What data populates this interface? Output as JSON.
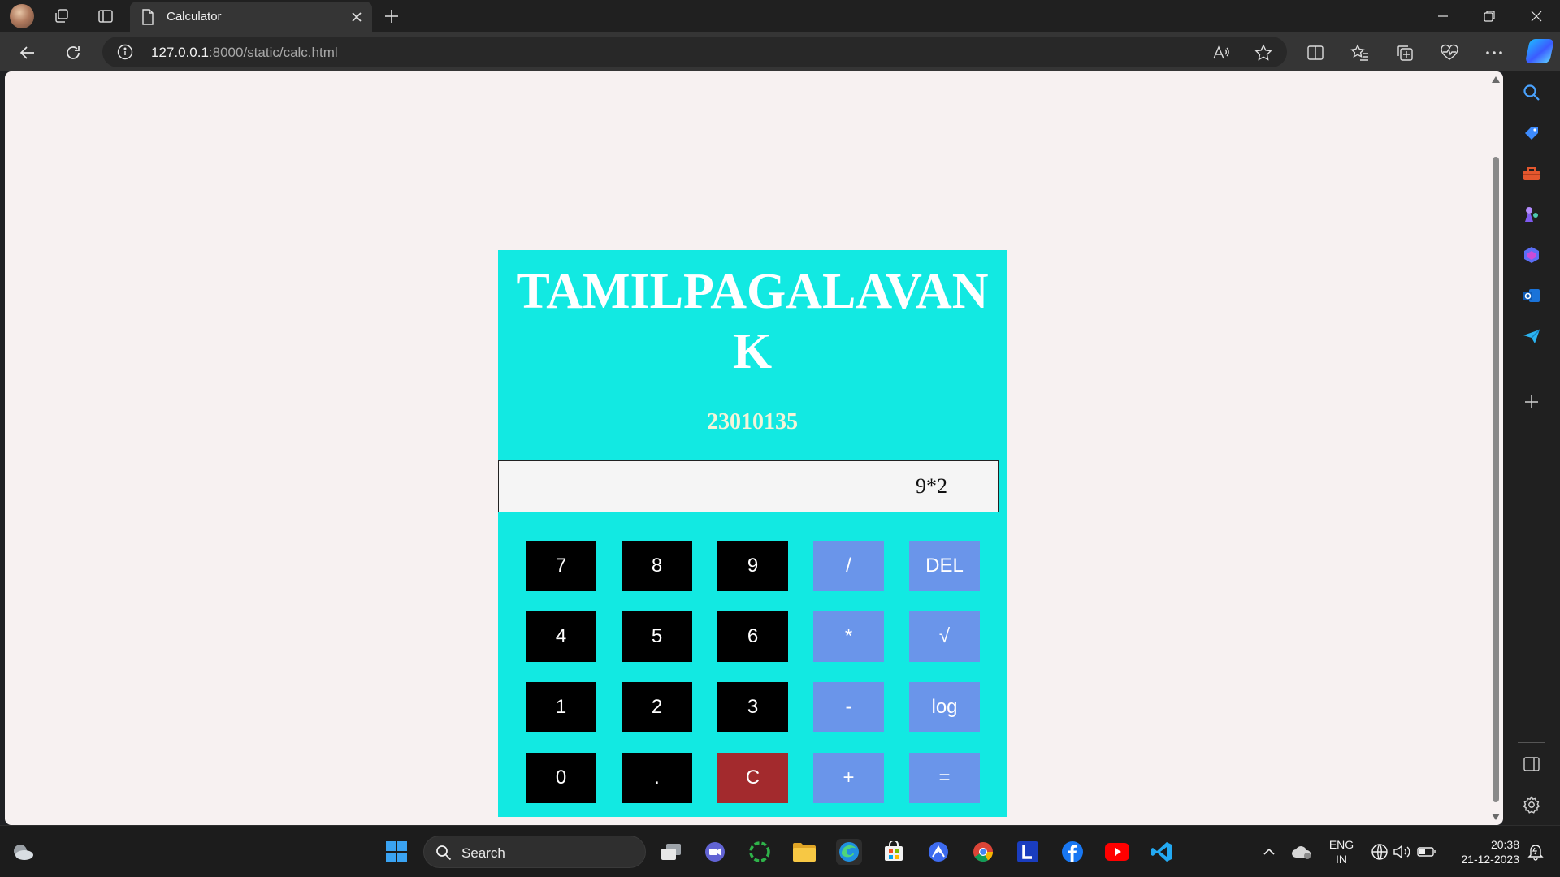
{
  "browser": {
    "tab_title": "Calculator",
    "url_host": "127.0.0.1",
    "url_rest": ":8000/static/calc.html"
  },
  "calculator": {
    "title": "TAMILPAGALAVAN K",
    "student_id": "23010135",
    "display_value": "9*2",
    "colors": {
      "panel": "#12e9e2",
      "number_key": "#000000",
      "operator_key": "#6a95ea",
      "clear_key": "#a32a2d"
    },
    "keys": [
      {
        "label": "7",
        "kind": "num"
      },
      {
        "label": "8",
        "kind": "num"
      },
      {
        "label": "9",
        "kind": "num"
      },
      {
        "label": "/",
        "kind": "op"
      },
      {
        "label": "DEL",
        "kind": "op"
      },
      {
        "label": "4",
        "kind": "num"
      },
      {
        "label": "5",
        "kind": "num"
      },
      {
        "label": "6",
        "kind": "num"
      },
      {
        "label": "*",
        "kind": "op"
      },
      {
        "label": "√",
        "kind": "op"
      },
      {
        "label": "1",
        "kind": "num"
      },
      {
        "label": "2",
        "kind": "num"
      },
      {
        "label": "3",
        "kind": "num"
      },
      {
        "label": "-",
        "kind": "op"
      },
      {
        "label": "log",
        "kind": "op"
      },
      {
        "label": "0",
        "kind": "num"
      },
      {
        "label": ".",
        "kind": "num"
      },
      {
        "label": "C",
        "kind": "clear"
      },
      {
        "label": "+",
        "kind": "op"
      },
      {
        "label": "=",
        "kind": "op"
      }
    ]
  },
  "taskbar": {
    "search_label": "Search",
    "language": "ENG",
    "region": "IN",
    "time": "20:38",
    "date": "21-12-2023"
  }
}
